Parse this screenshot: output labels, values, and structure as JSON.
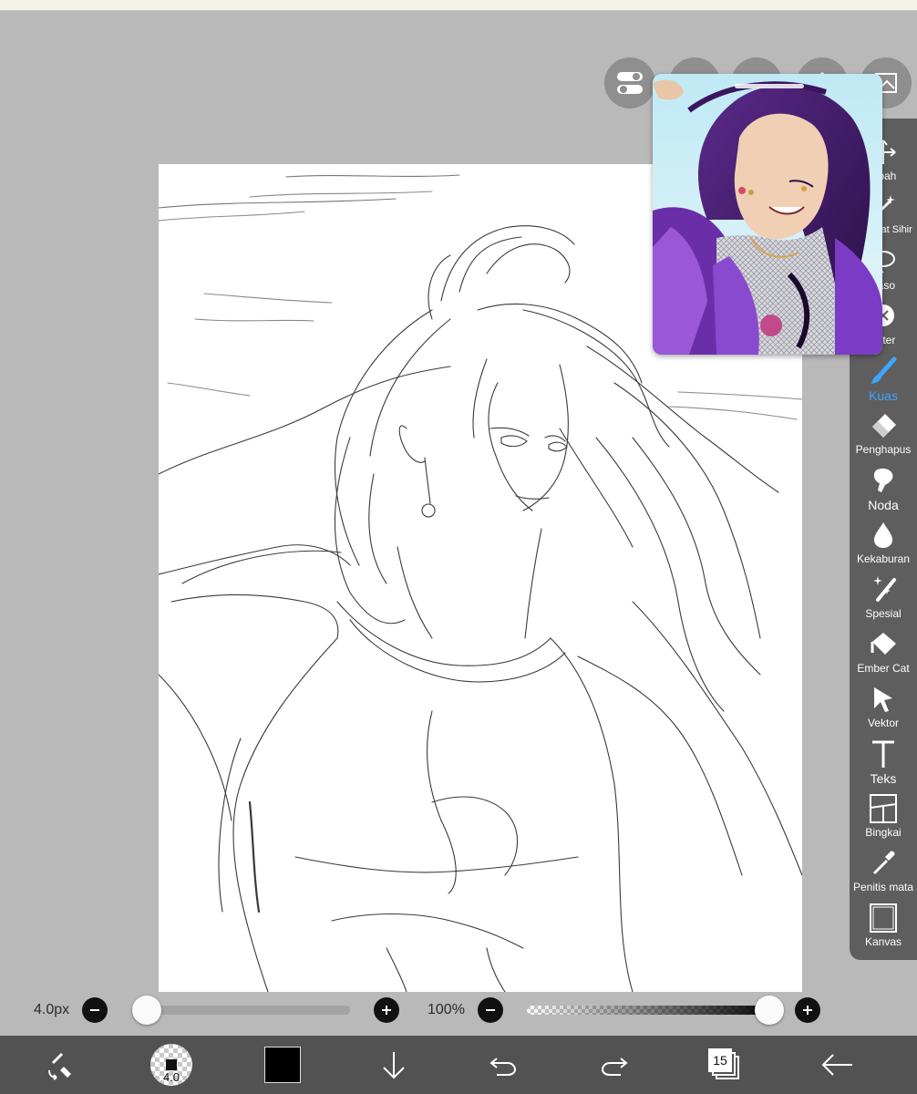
{
  "toolbar": {
    "tools": [
      {
        "label": "Ubah",
        "icon": "transform-icon"
      },
      {
        "label": "Tongkat Sihir",
        "icon": "magic-wand-icon"
      },
      {
        "label": "Laso",
        "icon": "lasso-icon"
      },
      {
        "label": "Filter",
        "icon": "filter-icon"
      },
      {
        "label": "Kuas",
        "icon": "brush-icon",
        "active": true
      },
      {
        "label": "Penghapus",
        "icon": "eraser-icon"
      },
      {
        "label": "Noda",
        "icon": "smudge-icon"
      },
      {
        "label": "Kekaburan",
        "icon": "blur-icon"
      },
      {
        "label": "Spesial",
        "icon": "special-icon"
      },
      {
        "label": "Ember Cat",
        "icon": "paint-bucket-icon"
      },
      {
        "label": "Vektor",
        "icon": "vector-icon"
      },
      {
        "label": "Teks",
        "icon": "text-icon"
      },
      {
        "label": "Bingkai",
        "icon": "frame-icon"
      },
      {
        "label": "Penitis mata",
        "icon": "eyedropper-icon"
      },
      {
        "label": "Kanvas",
        "icon": "canvas-icon"
      }
    ]
  },
  "brush": {
    "size_label": "4.0px",
    "size_level": 0.0,
    "opacity_label": "100%",
    "opacity_level": 1.0
  },
  "bottom_bar": {
    "brush_size_badge": "4.0",
    "layer_count": "15",
    "color_hex": "#000000"
  },
  "colors": {
    "accent": "#3ea6ff",
    "panel": "#5e5e5e",
    "workspace": "#b9b9b9",
    "bottom_bar": "#525252"
  }
}
